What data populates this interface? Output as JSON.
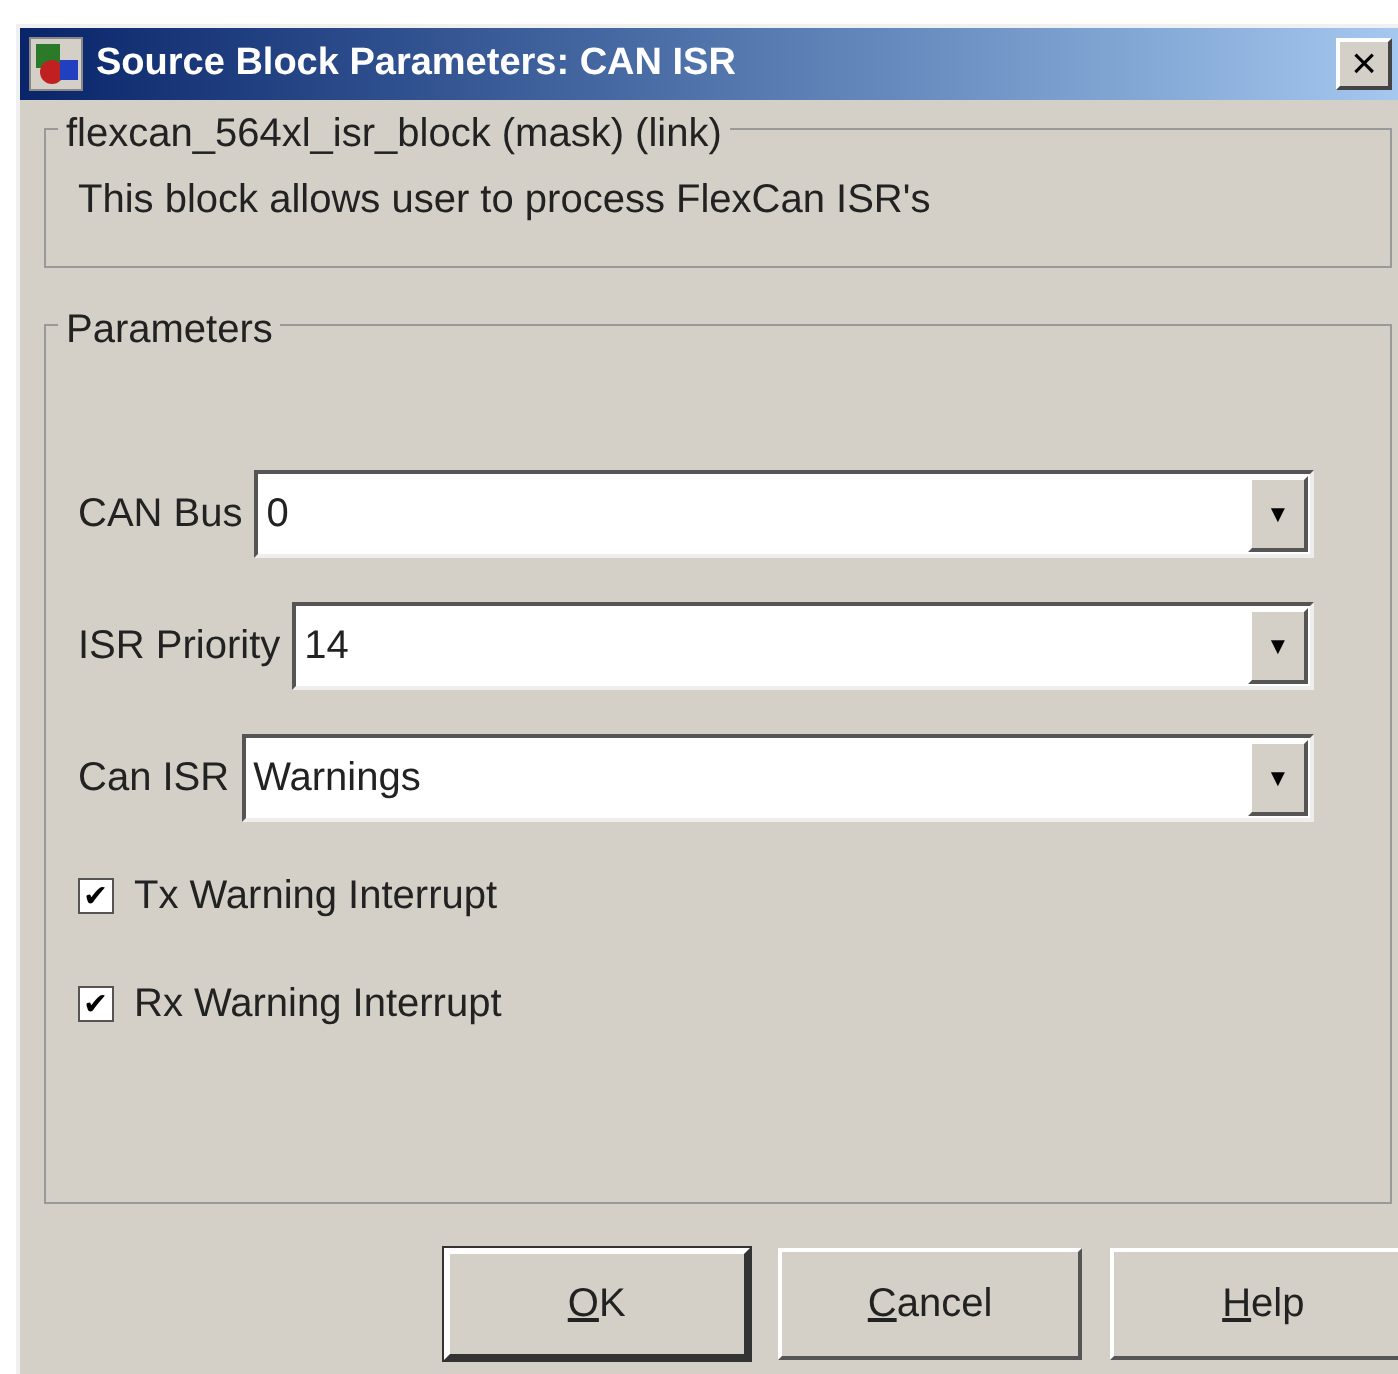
{
  "window": {
    "title": "Source Block Parameters: CAN ISR",
    "close": "×"
  },
  "mask_group": {
    "title": "flexcan_564xl_isr_block (mask) (link)",
    "description": "This block allows user to process FlexCan ISR's"
  },
  "parameters": {
    "title": "Parameters",
    "fields": [
      {
        "kind": "combo",
        "label": "CAN Bus",
        "value": "0",
        "arrow": "▼"
      },
      {
        "kind": "combo",
        "label": "ISR Priority",
        "value": "14",
        "arrow": "▼"
      },
      {
        "kind": "combo",
        "label": "Can ISR",
        "value": "Warnings",
        "arrow": "▼"
      },
      {
        "kind": "checkbox",
        "label": "Tx Warning Interrupt",
        "checked": true,
        "tick": "✔"
      },
      {
        "kind": "checkbox",
        "label": "Rx Warning Interrupt",
        "checked": true,
        "tick": "✔"
      }
    ]
  },
  "buttons": [
    {
      "underlined": "O",
      "rest": "K",
      "default": true
    },
    {
      "underlined": "C",
      "rest": "ancel",
      "default": false
    },
    {
      "underlined": "H",
      "rest": "elp",
      "default": false
    }
  ]
}
